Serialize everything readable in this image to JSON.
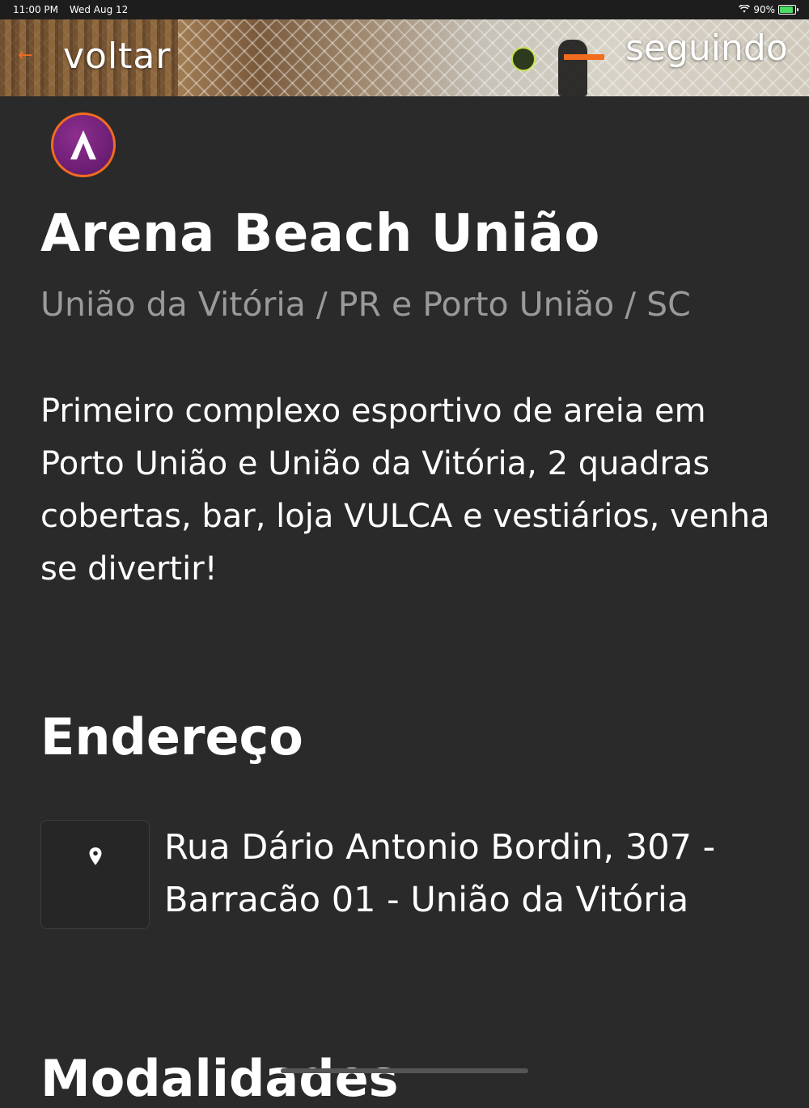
{
  "status_bar": {
    "time": "11:00 PM",
    "date": "Wed Aug 12",
    "battery": "90%"
  },
  "header": {
    "back_label": "voltar",
    "follow_label": "seguindo"
  },
  "venue": {
    "logo_icon": "arena-logo-icon",
    "name": "Arena Beach União",
    "location": "União da Vitória / PR e Porto União / SC",
    "description": "Primeiro complexo esportivo de areia em Porto União e União da Vitória, 2 quadras cobertas, bar, loja VULCA e vestiários, venha se divertir!"
  },
  "address_section": {
    "heading": "Endereço",
    "icon": "map-pin-icon",
    "address": "Rua Dário Antonio Bordin, 307 - Barracão 01 - União da Vitória"
  },
  "next_section": {
    "heading": "Modalidades"
  },
  "colors": {
    "accent": "#f26c1f",
    "background": "#2a2a2b",
    "muted": "#9a9a9a",
    "logo": "#6e1f78"
  }
}
